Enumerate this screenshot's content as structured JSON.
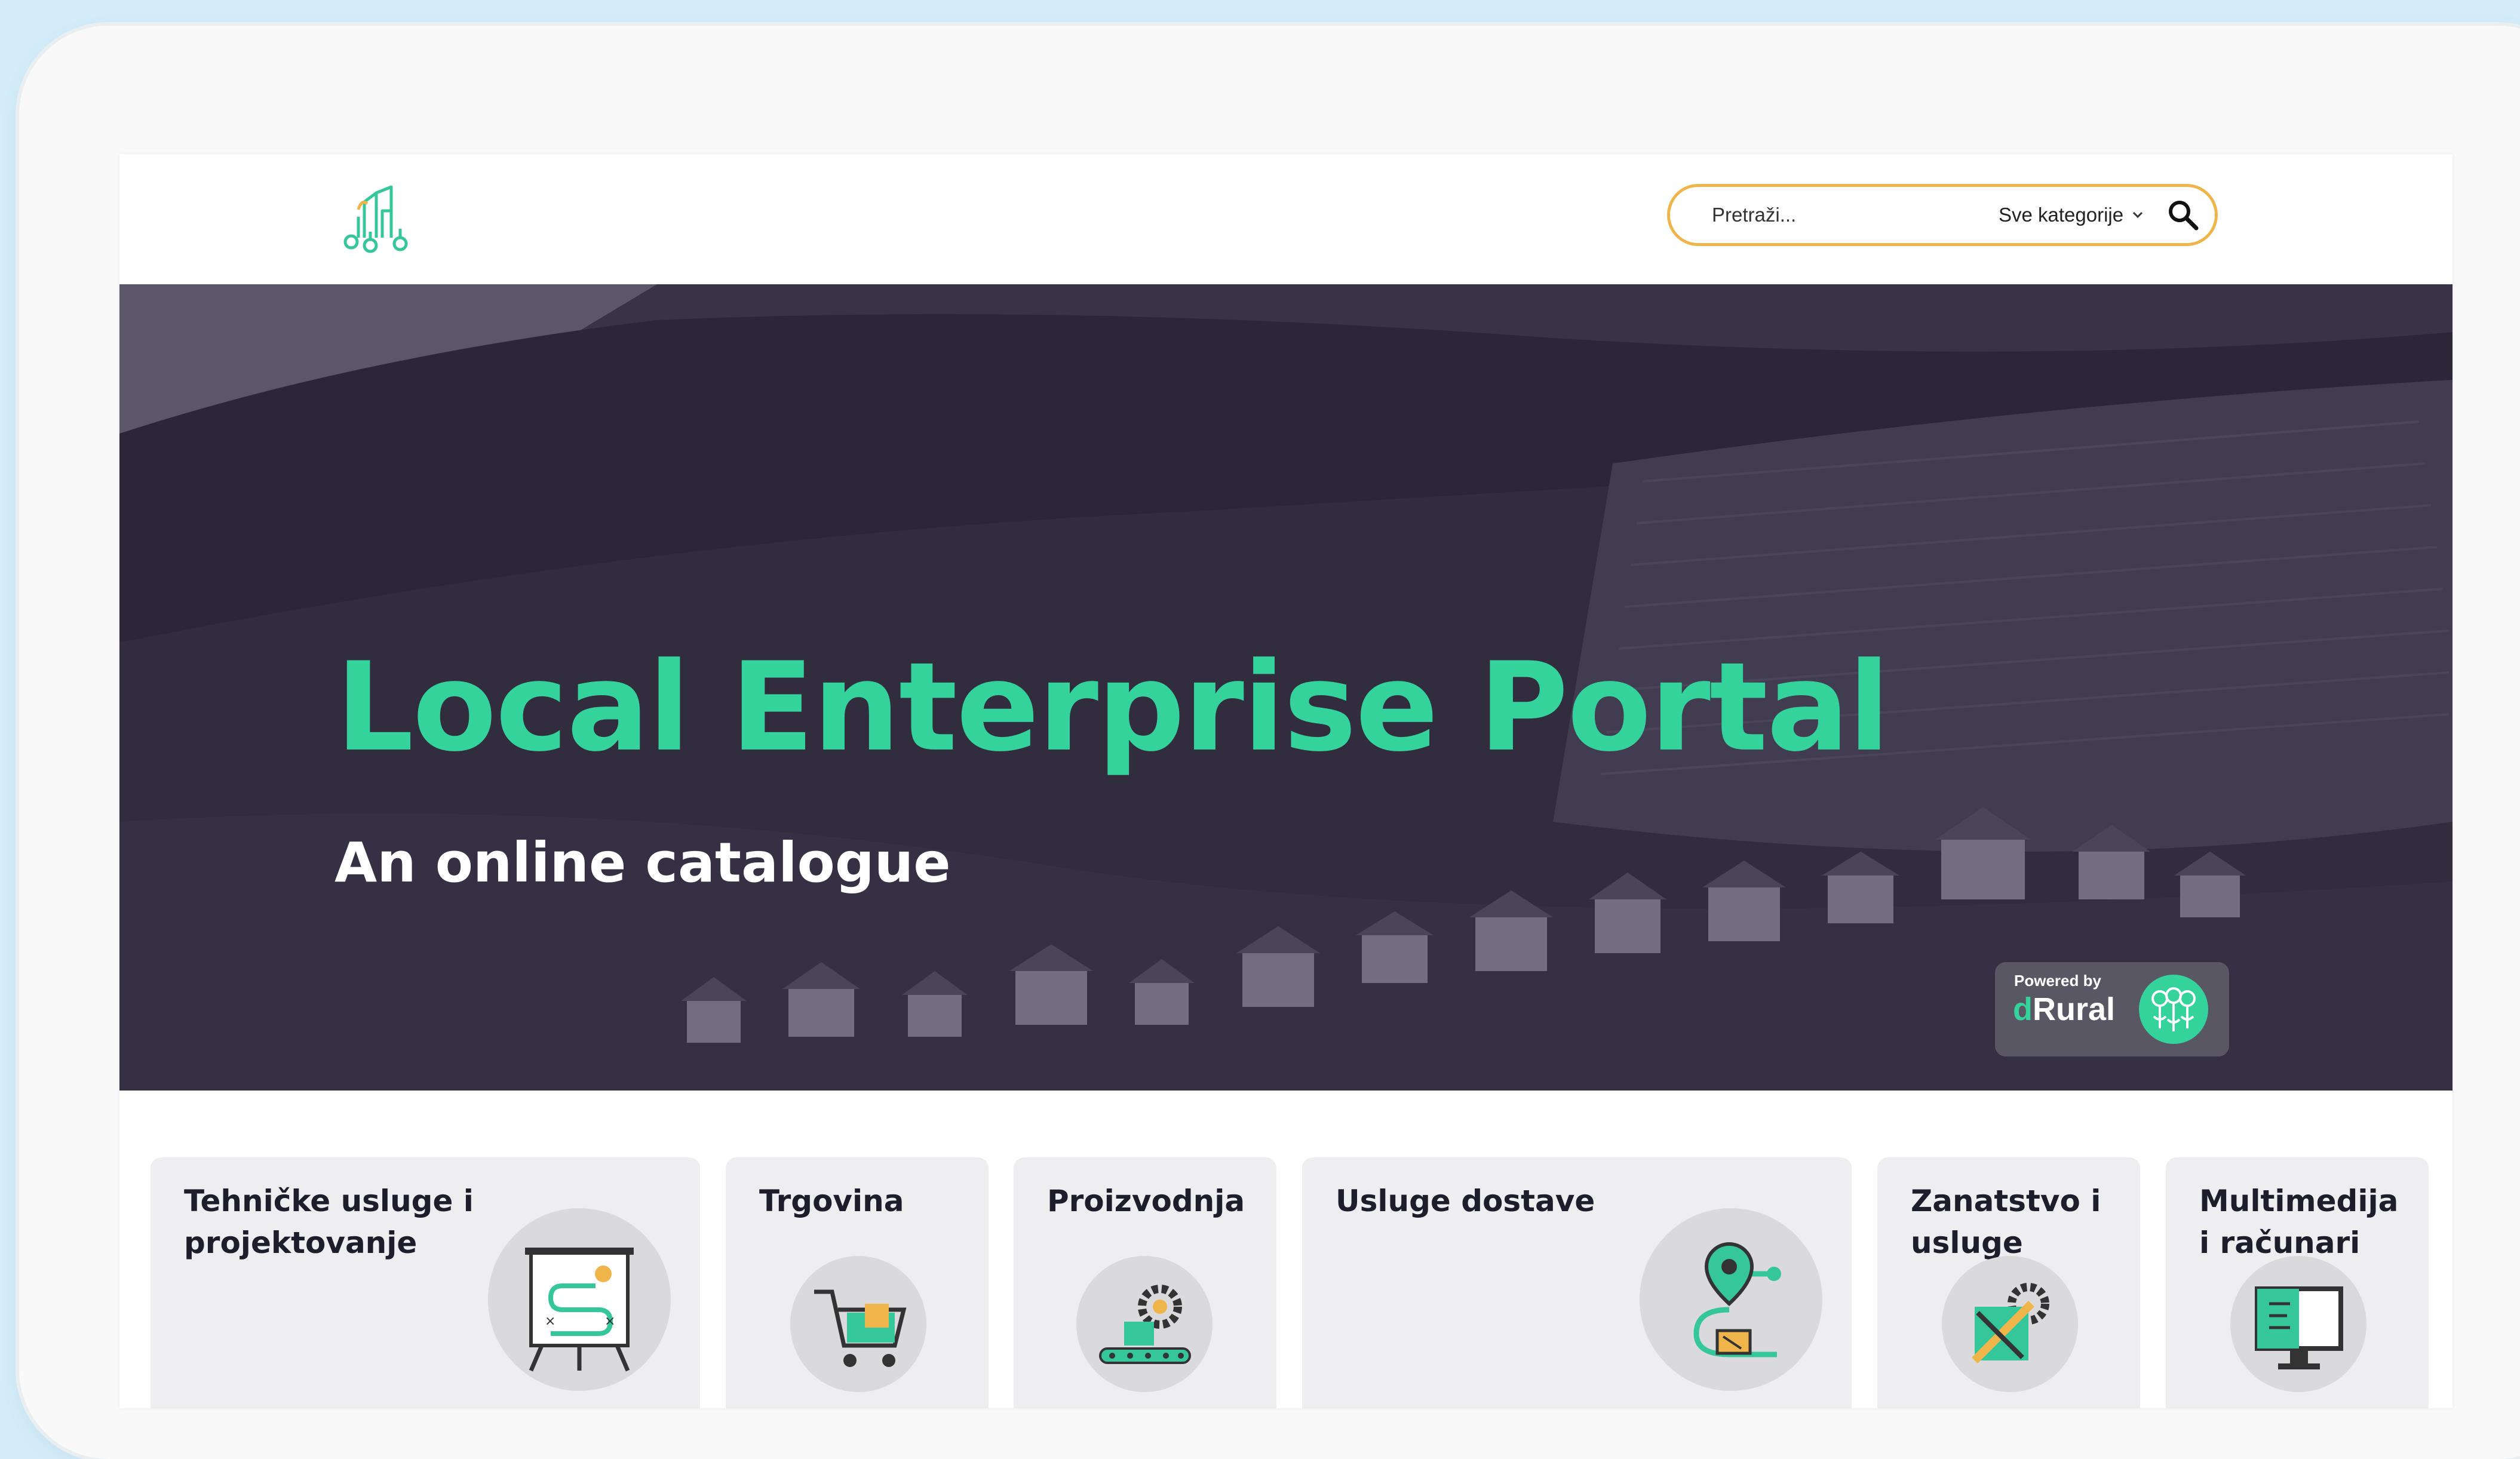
{
  "search": {
    "placeholder": "Pretraži...",
    "category_label": "Sve kategorije"
  },
  "hero": {
    "title": "Local Enterprise Portal",
    "subtitle": "An online catalogue"
  },
  "badge": {
    "small": "Powered by",
    "brand_d": "d",
    "brand_rest": "Rural"
  },
  "categories": [
    {
      "label": "Tehničke usluge i\nprojektovanje",
      "icon": "presentation-board-icon"
    },
    {
      "label": "Trgovina",
      "icon": "shopping-cart-icon"
    },
    {
      "label": "Proizvodnja",
      "icon": "conveyor-gear-icon"
    },
    {
      "label": "Usluge dostave",
      "icon": "delivery-route-icon"
    },
    {
      "label": "Zanatstvo i\nusluge",
      "icon": "tools-gear-icon"
    },
    {
      "label": "Multimedija\ni računari",
      "icon": "computer-monitor-icon"
    }
  ],
  "colors": {
    "accent_green": "#35d39c",
    "search_border": "#f0b54a",
    "hero_overlay": "#3f3b48",
    "card_bg": "#eeeef0"
  }
}
